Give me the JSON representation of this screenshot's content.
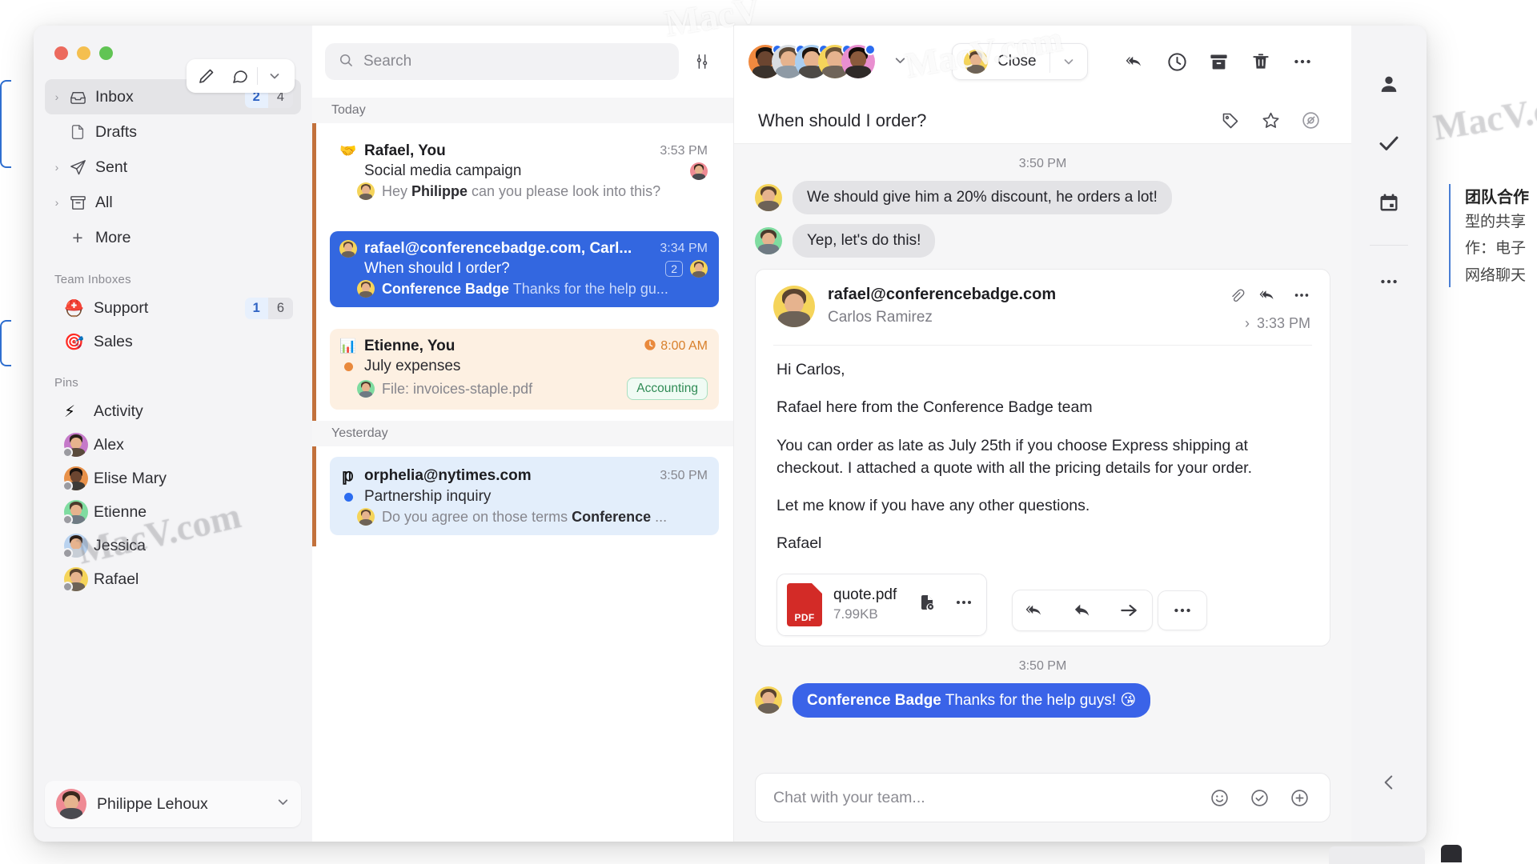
{
  "window": {
    "traffic_lights": [
      "close",
      "minimize",
      "zoom"
    ],
    "compose_icons": [
      "pencil-icon",
      "chat-bubble-icon",
      "chevron-down-icon"
    ]
  },
  "sidebar": {
    "folders": [
      {
        "label": "Inbox",
        "icon": "inbox-icon",
        "chevron": true,
        "unread": "2",
        "total": "4",
        "active": true
      },
      {
        "label": "Drafts",
        "icon": "draft-icon",
        "chevron": false,
        "unread": "",
        "total": "",
        "active": false
      },
      {
        "label": "Sent",
        "icon": "sent-icon",
        "chevron": true,
        "unread": "",
        "total": "",
        "active": false
      },
      {
        "label": "All",
        "icon": "archive-icon",
        "chevron": true,
        "unread": "",
        "total": "",
        "active": false
      },
      {
        "label": "More",
        "icon": "plus-icon",
        "chevron": false,
        "unread": "",
        "total": "",
        "active": false
      }
    ],
    "team_inboxes_title": "Team Inboxes",
    "team_inboxes": [
      {
        "label": "Support",
        "emoji": "⛑️",
        "unread": "1",
        "total": "6"
      },
      {
        "label": "Sales",
        "emoji": "🎯",
        "unread": "",
        "total": ""
      }
    ],
    "pins_title": "Pins",
    "pins": [
      {
        "label": "Activity",
        "emoji": "⚡",
        "type": "emoji"
      },
      {
        "label": "Alex",
        "type": "avatar",
        "bg": "#c579c9",
        "hair": "#2b2119",
        "shirt": "#5a4a3c"
      },
      {
        "label": "Elise Mary",
        "type": "avatar",
        "bg": "#e8914a",
        "hair": "#1c140f",
        "shirt": "#3d3a36"
      },
      {
        "label": "Etienne",
        "type": "avatar",
        "bg": "#7fdca0",
        "hair": "#4a3a2c",
        "shirt": "#6f7a83"
      },
      {
        "label": "Jessica",
        "type": "avatar",
        "bg": "#b9d2ef",
        "hair": "#2b1d16",
        "shirt": "#c8ced6"
      },
      {
        "label": "Rafael",
        "type": "avatar",
        "bg": "#f5d45a",
        "hair": "#5a4330",
        "shirt": "#6d6257"
      }
    ],
    "user": {
      "name": "Philippe Lehoux",
      "avatar_bg": "#ef8a94"
    }
  },
  "search": {
    "placeholder": "Search",
    "icon": "search-icon",
    "filter_icon": "filter-sliders-icon"
  },
  "message_list": {
    "groups": [
      {
        "day": "Today",
        "messages": [
          {
            "from": "Rafael, You",
            "time": "3:53 PM",
            "subject": "Social media campaign",
            "preview_bold": "Philippe",
            "preview_before": "Hey ",
            "preview_after": " can you please look into this?",
            "mark": "🤝",
            "mark_type": "emoji",
            "style": "plain",
            "right_avatar_bg": "#ef8a94",
            "badge": "",
            "tag": "",
            "clock": false
          },
          {
            "from": "rafael@conferencebadge.com, Carl...",
            "time": "3:34 PM",
            "subject": "When should I order?",
            "preview_bold": "Conference Badge",
            "preview_before": "",
            "preview_after": " Thanks for the help gu...",
            "mark": "avatar",
            "mark_type": "avatar",
            "mark_avatar_bg": "#f5d45a",
            "style": "selected",
            "right_avatar_bg": "#f5d45a",
            "badge": "2",
            "tag": "",
            "clock": false
          },
          {
            "from": "Etienne, You",
            "time": "8:00 AM",
            "subject": "July expenses",
            "preview_bold": "",
            "preview_before": "File: invoices-staple.pdf",
            "preview_after": "",
            "mark": "📊",
            "mark_type": "emoji",
            "style": "amber",
            "dot_color": "#e9893c",
            "right_avatar_bg": "#7fdca0",
            "badge": "",
            "tag": "Accounting",
            "clock": true
          }
        ]
      },
      {
        "day": "Yesterday",
        "messages": [
          {
            "from": "orphelia@nytimes.com",
            "time": "3:50 PM",
            "subject": "Partnership inquiry",
            "preview_bold": "Conference ",
            "preview_before": "Do you agree on those terms ",
            "preview_after": "...",
            "mark": "𝕡",
            "mark_type": "glyph",
            "style": "lightblue",
            "dot_color": "#2b6cf0",
            "right_avatar_bg": "#f5d45a",
            "badge": "",
            "tag": "",
            "clock": false
          }
        ]
      }
    ]
  },
  "conversation": {
    "participants": [
      {
        "bg": "#f0893f",
        "hair": "#1a120c",
        "shirt": "#3a322c"
      },
      {
        "bg": "#d9dde2",
        "hair": "#5d4a38",
        "shirt": "#8e9aa5"
      },
      {
        "bg": "#a9cef1",
        "hair": "#1d140e",
        "shirt": "#4d4a46"
      },
      {
        "bg": "#f5d45a",
        "hair": "#6b5338",
        "shirt": "#6f6459"
      },
      {
        "bg": "#e98fd0",
        "hair": "#140d09",
        "shirt": "#2f2a28"
      }
    ],
    "stack_chevron": "chevron-down-icon",
    "close_button": {
      "label": "Close",
      "avatar_bg": "#f5d45a",
      "chevron": "chevron-down-icon"
    },
    "toolbar_icons": [
      "reply-all-icon",
      "snooze-clock-icon",
      "archive-icon",
      "trash-icon",
      "more-icon"
    ],
    "title": "When should I order?",
    "title_icons": [
      "tag-icon",
      "star-icon",
      "eye-slash-icon"
    ],
    "chat_top": {
      "timestamp": "3:50 PM",
      "messages": [
        {
          "text": "We should give him a 20% discount, he orders a lot!",
          "avatar_bg": "#f5d45a",
          "style": "grey"
        },
        {
          "text": "Yep, let's do this!",
          "avatar_bg": "#7fdca0",
          "style": "grey"
        }
      ]
    },
    "email": {
      "address": "rafael@conferencebadge.com",
      "sender_name": "Carlos Ramirez",
      "time": "3:33 PM",
      "avatar_bg": "#f5d45a",
      "head_icons": [
        "paperclip-icon",
        "reply-all-icon",
        "more-icon"
      ],
      "paragraphs": [
        "Hi Carlos,",
        "Rafael here from the Conference Badge team",
        "You can order as late as July 25th if you choose Express shipping at checkout. I attached a quote with all the pricing details for your order.",
        "Let me know if you have any other questions.",
        "Rafael"
      ],
      "attachment": {
        "name": "quote.pdf",
        "size": "7.99KB",
        "type": "PDF",
        "icons": [
          "preview-file-icon",
          "more-icon"
        ]
      },
      "reply_buttons": [
        "reply-all-icon",
        "reply-icon",
        "forward-icon",
        "more-icon"
      ]
    },
    "chat_bottom": {
      "timestamp": "3:50 PM",
      "message": {
        "bold": "Conference Badge",
        "text": " Thanks for the help guys! 😘",
        "avatar_bg": "#f5d45a",
        "style": "blue"
      }
    },
    "composer": {
      "placeholder": "Chat with your team...",
      "icons": [
        "emoji-icon",
        "task-check-icon",
        "plus-circle-icon"
      ]
    }
  },
  "right_rail": {
    "icons": [
      "person-icon",
      "check-icon",
      "calendar-icon",
      "more-icon"
    ],
    "collapse_icon": "chevron-left-icon"
  },
  "overlay": {
    "note_title": "团队合作",
    "note_lines": [
      "型的共享",
      "作：电子",
      "网络聊天"
    ],
    "watermarks": [
      "MacV",
      "MacV.com",
      "MacV.co",
      "MacV.com"
    ]
  },
  "colors": {
    "accent_blue": "#3367e0",
    "left_stripe": "#c2713c",
    "amber_bg": "#fdf0e2",
    "lightblue_bg": "#e3eefb",
    "tag_green": "#2f8b55"
  }
}
